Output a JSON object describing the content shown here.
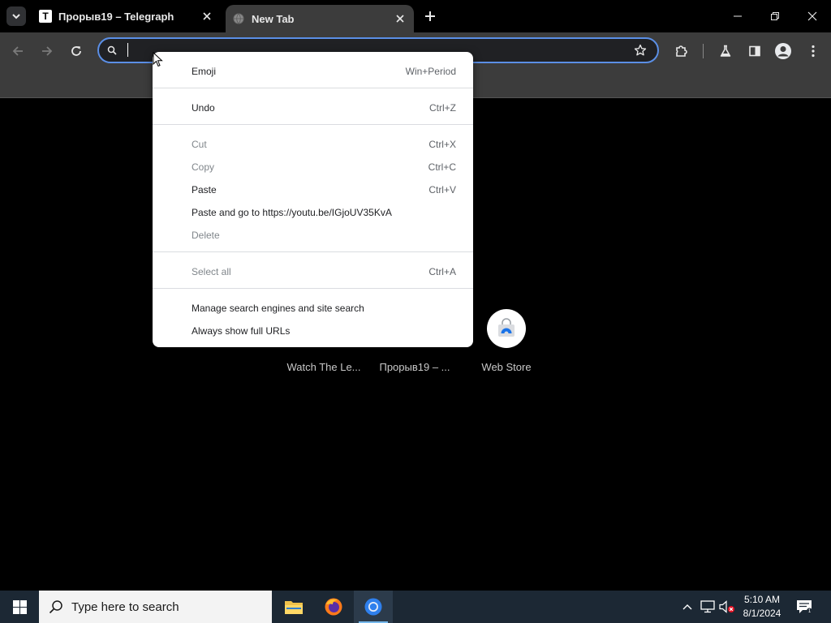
{
  "tabs": [
    {
      "favicon": "T",
      "title": "Прорыв19 – Telegraph",
      "active": false
    },
    {
      "favicon": "globe-icon",
      "title": "New Tab",
      "active": true
    }
  ],
  "toolbar": {
    "omnibox_value": ""
  },
  "context_menu": {
    "items": [
      {
        "label": "Emoji",
        "accel": "Win+Period",
        "enabled": true
      },
      {
        "label": "Undo",
        "accel": "Ctrl+Z",
        "enabled": true
      },
      {
        "label": "Cut",
        "accel": "Ctrl+X",
        "enabled": false
      },
      {
        "label": "Copy",
        "accel": "Ctrl+C",
        "enabled": false
      },
      {
        "label": "Paste",
        "accel": "Ctrl+V",
        "enabled": true
      },
      {
        "label": "Paste and go to https://youtu.be/IGjoUV35KvA",
        "accel": "",
        "enabled": true
      },
      {
        "label": "Delete",
        "accel": "",
        "enabled": false
      },
      {
        "label": "Select all",
        "accel": "Ctrl+A",
        "enabled": false
      },
      {
        "label": "Manage search engines and site search",
        "accel": "",
        "enabled": true
      },
      {
        "label": "Always show full URLs",
        "accel": "",
        "enabled": true
      }
    ]
  },
  "shortcuts": [
    {
      "label": "Watch The Le..."
    },
    {
      "label": "Прорыв19 – ..."
    },
    {
      "label": "Web Store"
    }
  ],
  "taskbar": {
    "search_placeholder": "Type here to search",
    "time": "5:10 AM",
    "date": "8/1/2024"
  },
  "colors": {
    "accent": "#5b8fe6",
    "toolbar_bg": "#3c3c3c",
    "menu_bg": "#ffffff",
    "taskbar_bg": "#1c2834"
  }
}
